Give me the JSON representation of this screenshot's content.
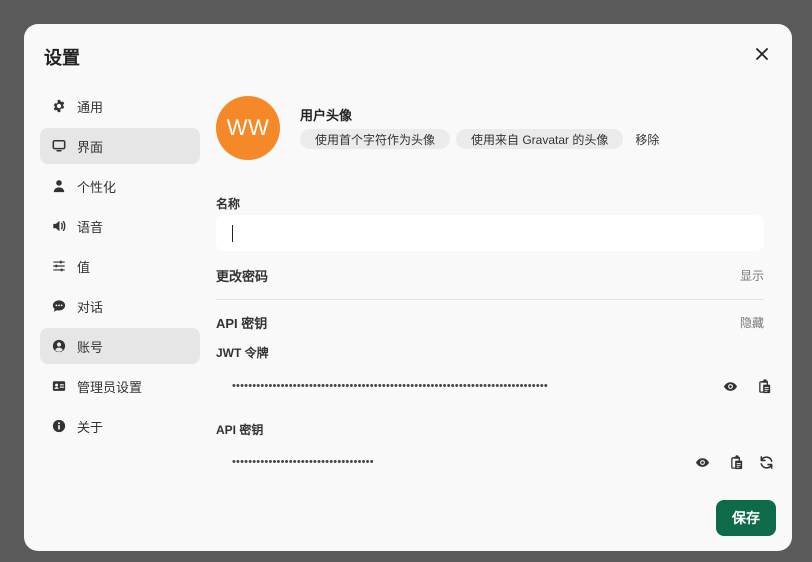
{
  "modal": {
    "title": "设置"
  },
  "sidebar": {
    "items": [
      {
        "label": "通用",
        "icon": "gear-icon"
      },
      {
        "label": "界面",
        "icon": "monitor-icon"
      },
      {
        "label": "个性化",
        "icon": "person-icon"
      },
      {
        "label": "语音",
        "icon": "speaker-icon"
      },
      {
        "label": "值",
        "icon": "sliders-icon"
      },
      {
        "label": "对话",
        "icon": "chat-icon"
      },
      {
        "label": "账号",
        "icon": "user-circle-icon"
      },
      {
        "label": "管理员设置",
        "icon": "id-card-icon"
      },
      {
        "label": "关于",
        "icon": "info-icon"
      }
    ],
    "active_items": [
      "界面",
      "账号"
    ]
  },
  "account": {
    "avatar_initials": "WW",
    "avatar_color": "#f5892a",
    "avatar_label": "用户头像",
    "use_initials_btn": "使用首个字符作为头像",
    "use_gravatar_btn": "使用来自 Gravatar 的头像",
    "remove_btn": "移除",
    "name_label": "名称",
    "name_value": "",
    "change_password_title": "更改密码",
    "change_password_action": "显示",
    "api_title": "API 密钥",
    "api_action": "隐藏",
    "jwt_label": "JWT 令牌",
    "jwt_masked": "••••••••••••••••••••••••••••••••••••••••••••••••••••••••••••••••••••••••••••••",
    "api_key_label": "API 密钥",
    "api_key_masked": "•••••••••••••••••••••••••••••••••••"
  },
  "footer": {
    "save_label": "保存",
    "save_color": "#0d6b4a"
  }
}
